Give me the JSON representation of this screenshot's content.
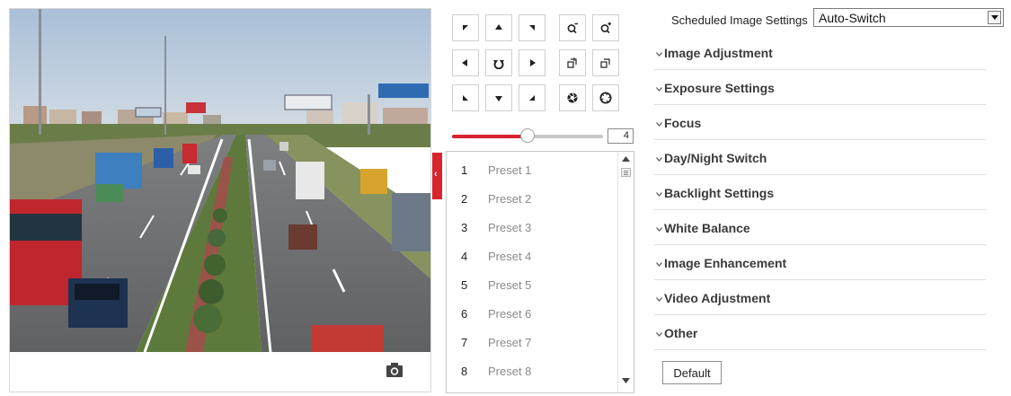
{
  "ptz": {
    "buttons": [
      {
        "name": "pan-up-left-button",
        "icon": "arrow-up-left-icon"
      },
      {
        "name": "pan-up-button",
        "icon": "arrow-up-icon"
      },
      {
        "name": "pan-up-right-button",
        "icon": "arrow-up-right-icon"
      },
      {
        "name": "zoom-out-button",
        "icon": "zoom-out-icon"
      },
      {
        "name": "zoom-in-button",
        "icon": "zoom-in-icon"
      },
      {
        "name": "pan-left-button",
        "icon": "arrow-left-icon"
      },
      {
        "name": "auto-pan-button",
        "icon": "auto-rotate-icon"
      },
      {
        "name": "pan-right-button",
        "icon": "arrow-right-icon"
      },
      {
        "name": "focus-near-button",
        "icon": "focus-near-icon"
      },
      {
        "name": "focus-far-button",
        "icon": "focus-far-icon"
      },
      {
        "name": "pan-down-left-button",
        "icon": "arrow-down-left-icon"
      },
      {
        "name": "pan-down-button",
        "icon": "arrow-down-icon"
      },
      {
        "name": "pan-down-right-button",
        "icon": "arrow-down-right-icon"
      },
      {
        "name": "iris-close-button",
        "icon": "iris-close-icon"
      },
      {
        "name": "iris-open-button",
        "icon": "iris-open-icon"
      }
    ],
    "speed": {
      "value": "4",
      "level_fraction": 0.5
    }
  },
  "presets": [
    {
      "number": "1",
      "name": "Preset 1"
    },
    {
      "number": "2",
      "name": "Preset 2"
    },
    {
      "number": "3",
      "name": "Preset 3"
    },
    {
      "number": "4",
      "name": "Preset 4"
    },
    {
      "number": "5",
      "name": "Preset 5"
    },
    {
      "number": "6",
      "name": "Preset 6"
    },
    {
      "number": "7",
      "name": "Preset 7"
    },
    {
      "number": "8",
      "name": "Preset 8"
    }
  ],
  "settings": {
    "schedule_label": "Scheduled Image Settings",
    "schedule_value": "Auto-Switch",
    "sections": [
      "Image Adjustment",
      "Exposure Settings",
      "Focus",
      "Day/Night Switch",
      "Backlight Settings",
      "White Balance",
      "Image Enhancement",
      "Video Adjustment",
      "Other"
    ],
    "default_label": "Default"
  },
  "colors": {
    "accent": "#d9232d",
    "border": "#cfcfcf",
    "section_text": "#3a3a3a",
    "preset_text": "#8a8a8a"
  },
  "icons": {
    "snapshot": "camera-icon",
    "collapse": "chevron-left-icon",
    "section_toggle": "chevron-down-icon"
  }
}
